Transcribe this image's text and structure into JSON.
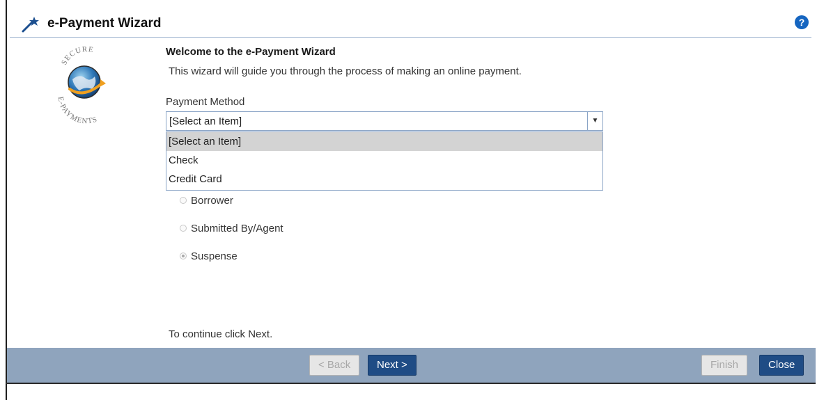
{
  "window": {
    "title": "e-Payment Wizard",
    "help_glyph": "?"
  },
  "icons": {
    "wand": "magic-wand-icon",
    "help": "help-icon",
    "logo": "secure-epayments-globe-logo"
  },
  "logo": {
    "top_text": "SECURE",
    "bottom_text": "E-PAYMENTS"
  },
  "content": {
    "heading": "Welcome to the e-Payment Wizard",
    "description": "This wizard will guide you through the process of making an online payment.",
    "payment_method_label": "Payment Method",
    "payment_method_value": "[Select an Item]",
    "payment_method_options": [
      "[Select an Item]",
      "Check",
      "Credit Card"
    ],
    "payer_options": [
      {
        "label": "Borrower",
        "checked": false
      },
      {
        "label": "Submitted By/Agent",
        "checked": false
      },
      {
        "label": "Suspense",
        "checked": true
      }
    ],
    "continue_text": "To continue click Next."
  },
  "buttons": {
    "back": "< Back",
    "next": "Next >",
    "finish": "Finish",
    "close": "Close"
  },
  "colors": {
    "footer_bg": "#8fa4bd",
    "primary_button": "#1f4c85",
    "help_icon": "#1565c0"
  }
}
